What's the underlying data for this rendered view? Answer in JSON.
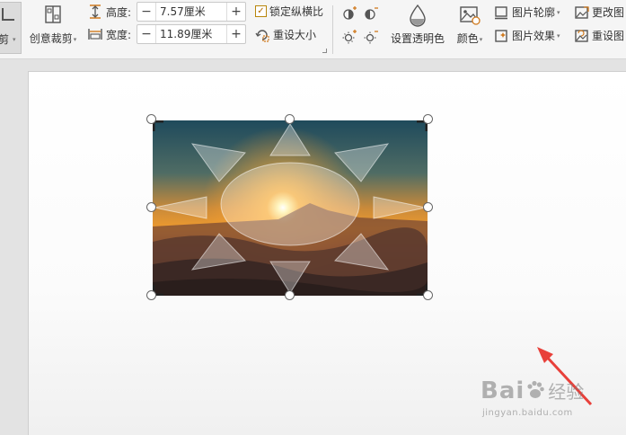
{
  "toolbar": {
    "crop_label": "剪",
    "creative_crop_label": "创意裁剪",
    "height_label": "高度:",
    "height_value": "7.57厘米",
    "width_label": "宽度:",
    "width_value": "11.89厘米",
    "lock_ratio_label": "锁定纵横比",
    "lock_ratio_checked": true,
    "reset_size_label": "重设大小",
    "transparent_label": "设置透明色",
    "color_label": "颜色",
    "outline_label": "图片轮廓",
    "effect_label": "图片效果",
    "change_pic_label": "更改图",
    "reset_pic_label": "重设图",
    "minus": "−",
    "plus": "+",
    "check_mark": "✓",
    "dropdown": "▾"
  },
  "watermark": {
    "brand": "Bai",
    "brand_cn": "经验",
    "url": "jingyan.baidu.com"
  },
  "colors": {
    "accent_orange": "#e8862a",
    "arrow_red": "#e8403a",
    "selection": "#555555"
  },
  "icons": [
    "crop-icon",
    "creative-crop-icon",
    "height-icon",
    "width-icon",
    "reset-size-icon",
    "brightness-up-icon",
    "contrast-up-icon",
    "brightness-down-icon",
    "contrast-down-icon",
    "transparent-color-icon",
    "color-icon",
    "outline-icon",
    "effect-icon",
    "change-picture-icon",
    "reset-picture-icon"
  ]
}
